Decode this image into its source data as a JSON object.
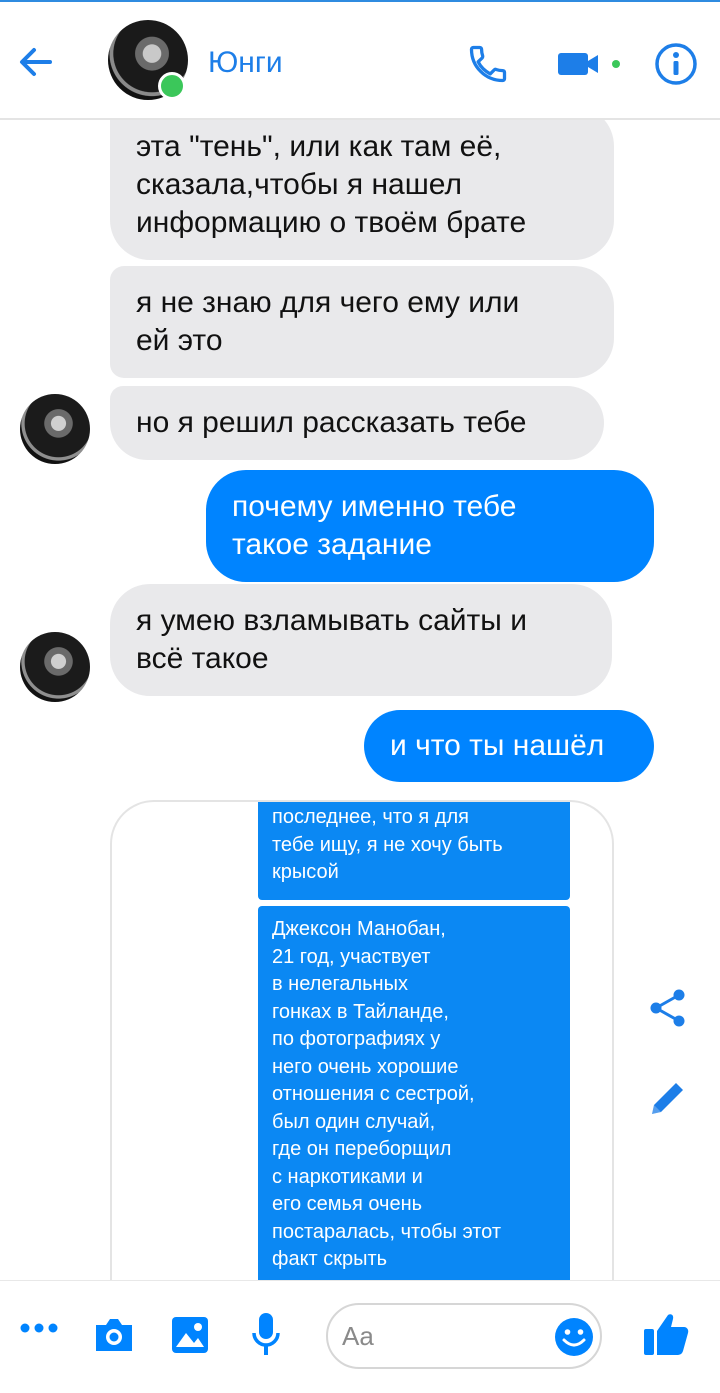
{
  "header": {
    "contact_name": "Юнги",
    "icons": [
      "back-arrow-icon",
      "phone-icon",
      "video-camera-icon",
      "info-icon"
    ],
    "accent": "#1d7ee8",
    "online_color": "#3bc75a"
  },
  "messages": [
    {
      "from": "them",
      "text": "эта \"тень\", или как там её,\nсказала,чтобы я нашел\nинформацию о твоём брате"
    },
    {
      "from": "them",
      "text": "я не знаю для чего ему или\nей это"
    },
    {
      "from": "them",
      "text": "но я решил рассказать тебе"
    },
    {
      "from": "me",
      "text": "почему именно тебе\nтакое задание"
    },
    {
      "from": "them",
      "text": "я умею взламывать сайты и\nвсё такое"
    },
    {
      "from": "me",
      "text": "и что ты нашёл"
    }
  ],
  "photo": {
    "bubble_1": "последнее, что я для\nтебе ищу, я не хочу быть\nкрысой",
    "bubble_2": "Джексон Манобан,\n21 год, участвует\nв нелегальных\nгонках в Тайланде,\nпо фотографиях у\nнего очень хорошие\nотношения с сестрой,\nбыл один случай,\nгде он переборщил\nс наркотиками и\nего семья очень\nпостаралась, чтобы этот\nфакт скрыть",
    "actions": [
      "share-icon",
      "edit-pencil-icon"
    ]
  },
  "composer": {
    "placeholder": "Aa",
    "icons": [
      "more-dots-icon",
      "camera-icon",
      "gallery-image-icon",
      "microphone-icon",
      "emoji-icon",
      "thumbs-up-icon"
    ],
    "icon_color": "#0084ff"
  },
  "colors": {
    "incoming_bubble": "#e9e9eb",
    "outgoing_bubble": "#0084ff"
  }
}
